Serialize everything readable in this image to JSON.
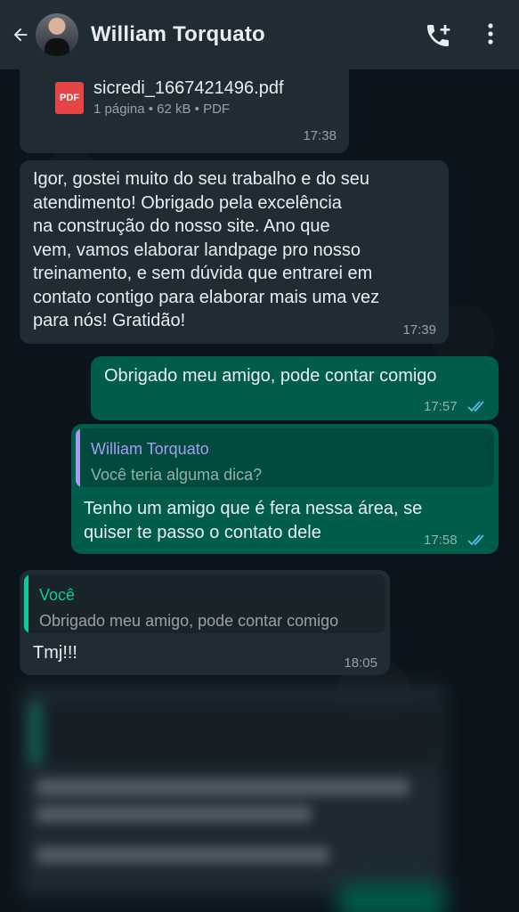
{
  "header": {
    "contact_name": "William Torquato",
    "back_icon": "arrow-left-icon",
    "call_icon": "add-call-icon",
    "menu_icon": "more-vertical-icon"
  },
  "colors": {
    "header_bg": "#1f2c34",
    "chat_bg": "#0b141a",
    "incoming_bubble": "#1f2c34",
    "outgoing_bubble": "#005c4b",
    "quote_name_purple": "#a79bf3",
    "quote_name_green": "#06cf9c",
    "read_ticks": "#53bdeb"
  },
  "messages": {
    "pdf": {
      "icon_label": "PDF",
      "file_name": "sicredi_1667421496.pdf",
      "meta": "1 página • 62 kB • PDF",
      "time": "17:38"
    },
    "igor": {
      "text": "Igor, gostei muito do seu trabalho e do seu\natendimento! Obrigado pela excelência\nna construção do nosso site. Ano que\nvem, vamos elaborar landpage pro nosso\ntreinamento, e sem dúvida que entrarei em\ncontato contigo para elaborar mais uma vez\npara nós! Gratidão!",
      "time": "17:39"
    },
    "obrigado": {
      "text": "Obrigado meu amigo, pode contar comigo",
      "time": "17:57"
    },
    "reply_amigo": {
      "quote_name": "William Torquato",
      "quote_text": "Você teria alguma dica?",
      "text": "Tenho um amigo que é fera nessa área, se\nquiser te passo o contato dele",
      "time": "17:58"
    },
    "tmj": {
      "quote_name": "Você",
      "quote_text": "Obrigado meu amigo, pode contar comigo",
      "text": "Tmj!!!",
      "time": "18:05"
    }
  }
}
